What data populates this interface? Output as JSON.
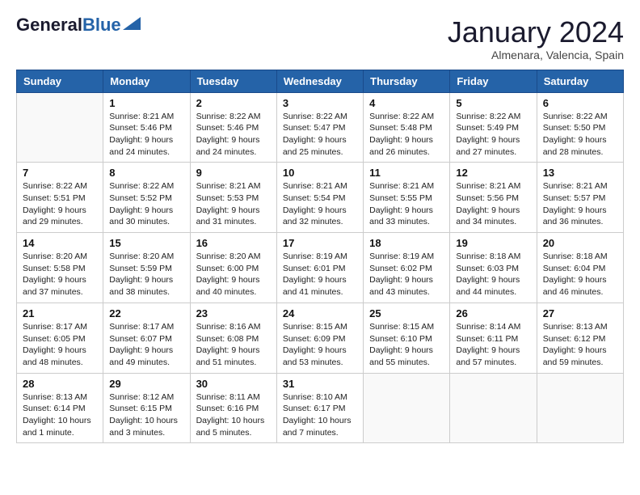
{
  "header": {
    "logo_general": "General",
    "logo_blue": "Blue",
    "month_title": "January 2024",
    "subtitle": "Almenara, Valencia, Spain"
  },
  "weekdays": [
    "Sunday",
    "Monday",
    "Tuesday",
    "Wednesday",
    "Thursday",
    "Friday",
    "Saturday"
  ],
  "weeks": [
    [
      {
        "day": "",
        "info": ""
      },
      {
        "day": "1",
        "info": "Sunrise: 8:21 AM\nSunset: 5:46 PM\nDaylight: 9 hours\nand 24 minutes."
      },
      {
        "day": "2",
        "info": "Sunrise: 8:22 AM\nSunset: 5:46 PM\nDaylight: 9 hours\nand 24 minutes."
      },
      {
        "day": "3",
        "info": "Sunrise: 8:22 AM\nSunset: 5:47 PM\nDaylight: 9 hours\nand 25 minutes."
      },
      {
        "day": "4",
        "info": "Sunrise: 8:22 AM\nSunset: 5:48 PM\nDaylight: 9 hours\nand 26 minutes."
      },
      {
        "day": "5",
        "info": "Sunrise: 8:22 AM\nSunset: 5:49 PM\nDaylight: 9 hours\nand 27 minutes."
      },
      {
        "day": "6",
        "info": "Sunrise: 8:22 AM\nSunset: 5:50 PM\nDaylight: 9 hours\nand 28 minutes."
      }
    ],
    [
      {
        "day": "7",
        "info": "Sunrise: 8:22 AM\nSunset: 5:51 PM\nDaylight: 9 hours\nand 29 minutes."
      },
      {
        "day": "8",
        "info": "Sunrise: 8:22 AM\nSunset: 5:52 PM\nDaylight: 9 hours\nand 30 minutes."
      },
      {
        "day": "9",
        "info": "Sunrise: 8:21 AM\nSunset: 5:53 PM\nDaylight: 9 hours\nand 31 minutes."
      },
      {
        "day": "10",
        "info": "Sunrise: 8:21 AM\nSunset: 5:54 PM\nDaylight: 9 hours\nand 32 minutes."
      },
      {
        "day": "11",
        "info": "Sunrise: 8:21 AM\nSunset: 5:55 PM\nDaylight: 9 hours\nand 33 minutes."
      },
      {
        "day": "12",
        "info": "Sunrise: 8:21 AM\nSunset: 5:56 PM\nDaylight: 9 hours\nand 34 minutes."
      },
      {
        "day": "13",
        "info": "Sunrise: 8:21 AM\nSunset: 5:57 PM\nDaylight: 9 hours\nand 36 minutes."
      }
    ],
    [
      {
        "day": "14",
        "info": "Sunrise: 8:20 AM\nSunset: 5:58 PM\nDaylight: 9 hours\nand 37 minutes."
      },
      {
        "day": "15",
        "info": "Sunrise: 8:20 AM\nSunset: 5:59 PM\nDaylight: 9 hours\nand 38 minutes."
      },
      {
        "day": "16",
        "info": "Sunrise: 8:20 AM\nSunset: 6:00 PM\nDaylight: 9 hours\nand 40 minutes."
      },
      {
        "day": "17",
        "info": "Sunrise: 8:19 AM\nSunset: 6:01 PM\nDaylight: 9 hours\nand 41 minutes."
      },
      {
        "day": "18",
        "info": "Sunrise: 8:19 AM\nSunset: 6:02 PM\nDaylight: 9 hours\nand 43 minutes."
      },
      {
        "day": "19",
        "info": "Sunrise: 8:18 AM\nSunset: 6:03 PM\nDaylight: 9 hours\nand 44 minutes."
      },
      {
        "day": "20",
        "info": "Sunrise: 8:18 AM\nSunset: 6:04 PM\nDaylight: 9 hours\nand 46 minutes."
      }
    ],
    [
      {
        "day": "21",
        "info": "Sunrise: 8:17 AM\nSunset: 6:05 PM\nDaylight: 9 hours\nand 48 minutes."
      },
      {
        "day": "22",
        "info": "Sunrise: 8:17 AM\nSunset: 6:07 PM\nDaylight: 9 hours\nand 49 minutes."
      },
      {
        "day": "23",
        "info": "Sunrise: 8:16 AM\nSunset: 6:08 PM\nDaylight: 9 hours\nand 51 minutes."
      },
      {
        "day": "24",
        "info": "Sunrise: 8:15 AM\nSunset: 6:09 PM\nDaylight: 9 hours\nand 53 minutes."
      },
      {
        "day": "25",
        "info": "Sunrise: 8:15 AM\nSunset: 6:10 PM\nDaylight: 9 hours\nand 55 minutes."
      },
      {
        "day": "26",
        "info": "Sunrise: 8:14 AM\nSunset: 6:11 PM\nDaylight: 9 hours\nand 57 minutes."
      },
      {
        "day": "27",
        "info": "Sunrise: 8:13 AM\nSunset: 6:12 PM\nDaylight: 9 hours\nand 59 minutes."
      }
    ],
    [
      {
        "day": "28",
        "info": "Sunrise: 8:13 AM\nSunset: 6:14 PM\nDaylight: 10 hours\nand 1 minute."
      },
      {
        "day": "29",
        "info": "Sunrise: 8:12 AM\nSunset: 6:15 PM\nDaylight: 10 hours\nand 3 minutes."
      },
      {
        "day": "30",
        "info": "Sunrise: 8:11 AM\nSunset: 6:16 PM\nDaylight: 10 hours\nand 5 minutes."
      },
      {
        "day": "31",
        "info": "Sunrise: 8:10 AM\nSunset: 6:17 PM\nDaylight: 10 hours\nand 7 minutes."
      },
      {
        "day": "",
        "info": ""
      },
      {
        "day": "",
        "info": ""
      },
      {
        "day": "",
        "info": ""
      }
    ]
  ]
}
